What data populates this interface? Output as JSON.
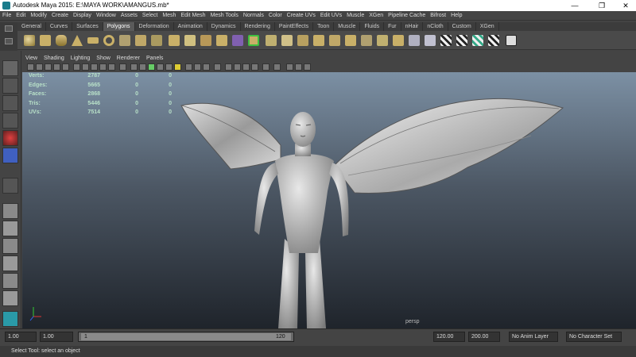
{
  "window": {
    "title": "Autodesk Maya 2015: E:\\MAYA WORK\\AMANGUS.mb*",
    "min": "—",
    "max": "❐",
    "close": "✕"
  },
  "menu": [
    "File",
    "Edit",
    "Modify",
    "Create",
    "Display",
    "Window",
    "Assets",
    "Select",
    "Mesh",
    "Edit Mesh",
    "Mesh Tools",
    "Normals",
    "Color",
    "Create UVs",
    "Edit UVs",
    "Muscle",
    "XGen",
    "Pipeline Cache",
    "Bifrost",
    "Help"
  ],
  "shelf_tabs": [
    "General",
    "Curves",
    "Surfaces",
    "Polygons",
    "Deformation",
    "Animation",
    "Dynamics",
    "Rendering",
    "PaintEffects",
    "Toon",
    "Muscle",
    "Fluids",
    "Fur",
    "nHair",
    "nCloth",
    "Custom",
    "XGen"
  ],
  "shelf_active": "Polygons",
  "viewport_menu": [
    "View",
    "Shading",
    "Lighting",
    "Show",
    "Renderer",
    "Panels"
  ],
  "stats": [
    {
      "label": "Verts:",
      "v1": "2787",
      "v2": "0",
      "v3": "0"
    },
    {
      "label": "Edges:",
      "v1": "5665",
      "v2": "0",
      "v3": "0"
    },
    {
      "label": "Faces:",
      "v1": "2868",
      "v2": "0",
      "v3": "0"
    },
    {
      "label": "Tris:",
      "v1": "5446",
      "v2": "0",
      "v3": "0"
    },
    {
      "label": "UVs:",
      "v1": "7514",
      "v2": "0",
      "v3": "0"
    }
  ],
  "camera_label": "persp",
  "time": {
    "start": "1.00",
    "current": "1.00",
    "range_start": "1",
    "range_end": "120",
    "end": "120.00",
    "max": "200.00",
    "anim_layer": "No Anim Layer",
    "char_set": "No Character Set"
  },
  "help": "Select Tool: select an object",
  "colors": {
    "accent": "#5a5a5a",
    "viewport_top": "#7c90a4",
    "viewport_bottom": "#1f242b",
    "stats_text": "#b8e0c8"
  }
}
